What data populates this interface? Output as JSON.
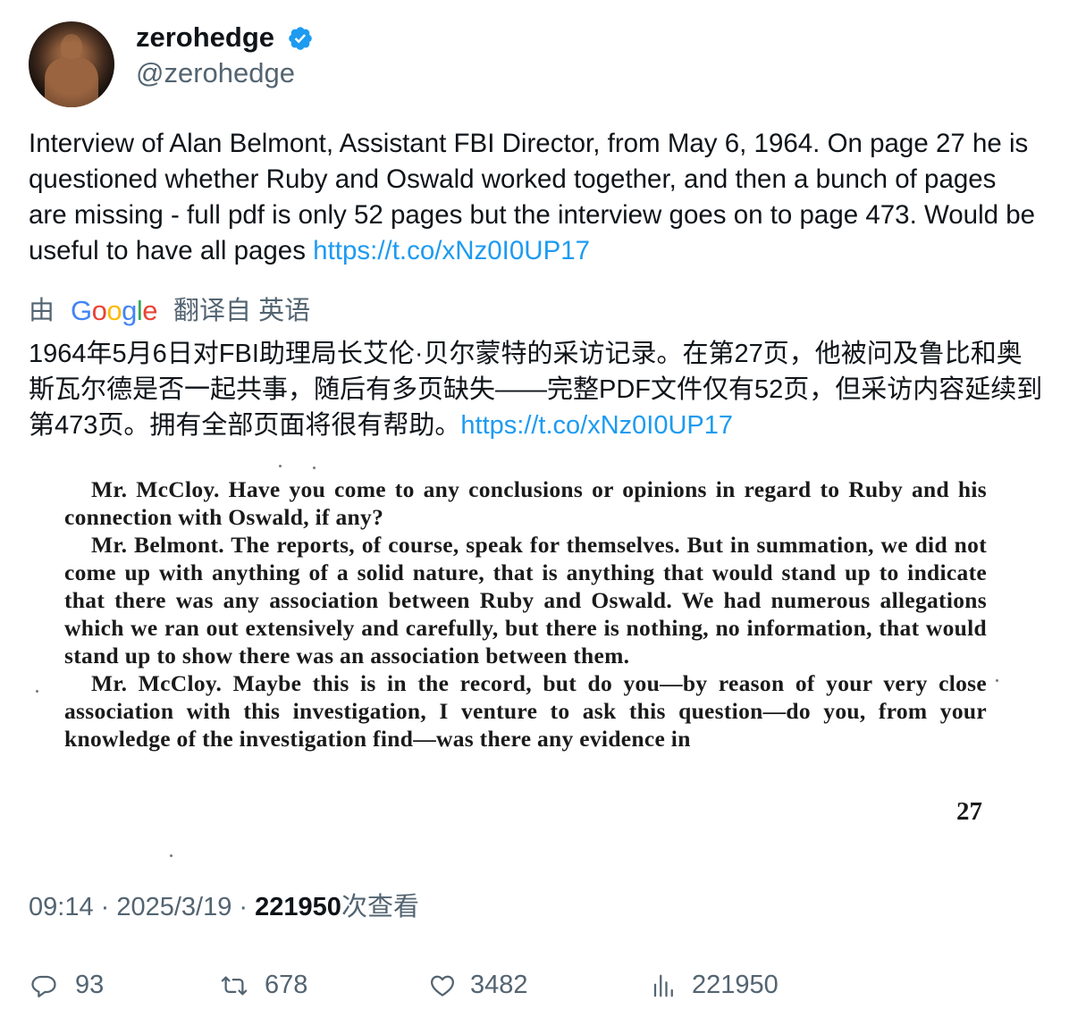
{
  "author": {
    "display_name": "zerohedge",
    "handle": "@zerohedge",
    "verified": true,
    "verified_color": "#1d9bf0"
  },
  "tweet": {
    "text": "Interview of Alan Belmont, Assistant FBI Director, from May 6, 1964. On page 27 he is questioned whether Ruby and Oswald worked together, and then a bunch of pages are missing - full pdf is only 52 pages but the interview goes on to page 473. Would be useful to have all pages ",
    "link": "https://t.co/xNz0I0UP17"
  },
  "translation": {
    "by_label": "由",
    "provider": "Google",
    "from_label": "翻译自 英语",
    "text": "1964年5月6日对FBI助理局长艾伦·贝尔蒙特的采访记录。在第27页，他被问及鲁比和奥斯瓦尔德是否一起共事，随后有多页缺失——完整PDF文件仅有52页，但采访内容延续到第473页。拥有全部页面将很有帮助。",
    "link": "https://t.co/xNz0I0UP17"
  },
  "scan": {
    "para1_speaker": "Mr. McCloy.",
    "para1": " Have you come to any conclusions or opinions in regard to Ruby and his connection with Oswald, if any?",
    "para2_speaker": "Mr. Belmont.",
    "para2": " The reports, of course, speak for themselves. But in summation, we did not come up with anything of a solid nature, that is anything that would stand up to indicate that there was any association between Ruby and Oswald. We had numerous allegations which we ran out extensively and carefully, but there is nothing, no information, that would stand up to show there was an association between them.",
    "para3_speaker": "Mr. McCloy.",
    "para3": " Maybe this is in the record, but do you—by reason of your very close association with this investigation, I venture to ask this question—do you, from your knowledge of the investigation find—was there any evidence in",
    "page_number": "27"
  },
  "meta": {
    "time": "09:14",
    "sep1": " · ",
    "date": "2025/3/19",
    "sep2": " · ",
    "views": "221950",
    "views_label": "次查看"
  },
  "actions": {
    "replies": "93",
    "retweets": "678",
    "likes": "3482",
    "views": "221950",
    "icon_color": "#536471"
  }
}
